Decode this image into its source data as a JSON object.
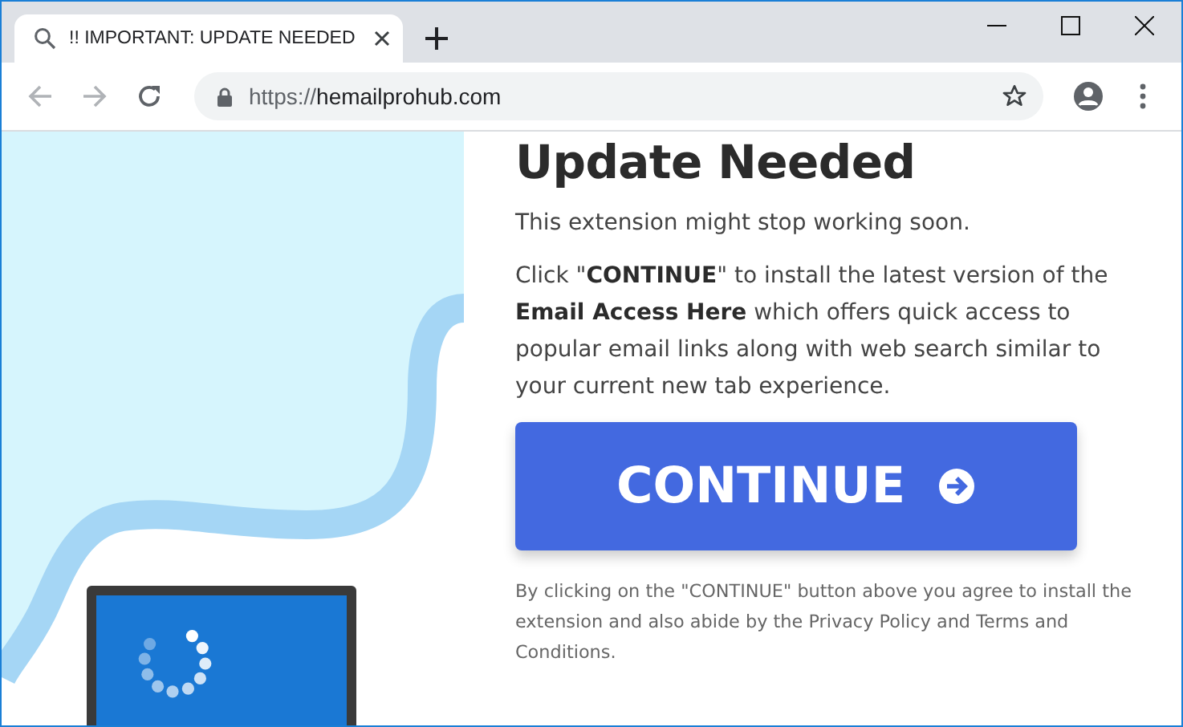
{
  "tabs": [
    {
      "title": "!! IMPORTANT: UPDATE NEEDED",
      "selected": true
    }
  ],
  "toolbar": {
    "url_scheme": "https://",
    "url_host": "hemailprohub.com"
  },
  "page": {
    "heading": "Update Needed",
    "intro": "This extension might stop working soon.",
    "body": "Click \"**CONTINUE**\" to install the latest version of the **Email Access Here** which offers quick access to popular email links along with web search similar to your current new tab experience.",
    "button": "CONTINUE",
    "disclaimer": "By clicking on the \"CONTINUE\" button above you agree to install the extension and also abide by the Privacy Policy and Terms and Conditions."
  }
}
